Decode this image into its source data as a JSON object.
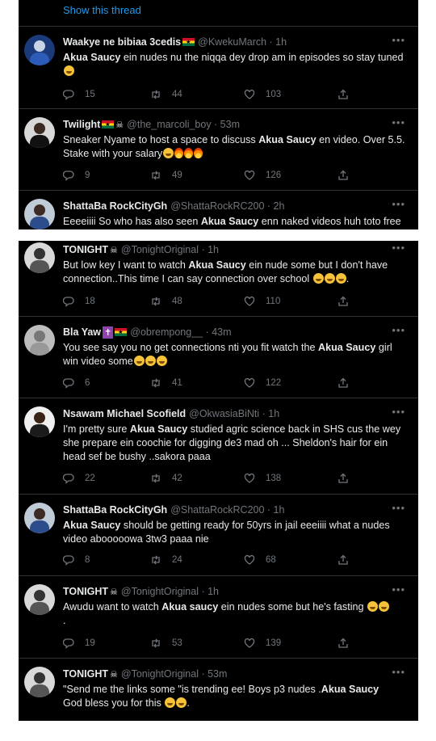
{
  "show_thread": "Show this thread",
  "more_label": "•••",
  "top_tweets": [
    {
      "name": "Waakye ne bibiaa 3cedis",
      "handle": "@KwekuMarch · 1h",
      "text": [
        "Akua Saucy",
        " ein nudes nu the niqqa dey drop am in episodes so stay tuned"
      ],
      "replies": "15",
      "retweets": "44",
      "likes": "103"
    },
    {
      "name": "Twilight",
      "handle": "@the_marcoli_boy · 53m",
      "text": [
        "Sneaker Nyame to host a space to discuss ",
        "Akua Saucy",
        " en video. Over 5.5. Stake with your salary"
      ],
      "replies": "9",
      "retweets": "49",
      "likes": "126"
    },
    {
      "name": "ShattaBa RockCityGh",
      "handle": "@ShattaRockRC200 · 2h",
      "text": [
        "Eeeeiiii So who has also seen ",
        "Akua Saucy",
        " enn naked videos huh toto free download abb aaaii"
      ]
    }
  ],
  "bottom_tweets": [
    {
      "name": "TONIGHT",
      "handle": "@TonightOriginal · 1h",
      "text": [
        "But low key I want to watch ",
        "Akua Saucy",
        " ein nude some but I don't have connection..This time I can say connection over school ",
        "."
      ],
      "replies": "18",
      "retweets": "48",
      "likes": "110"
    },
    {
      "name": "Bla Yaw",
      "handle": "@obrempong__ · 43m",
      "text": [
        "You see say you no get connections nti you fit watch the ",
        "Akua Saucy",
        " girl win video some"
      ],
      "replies": "6",
      "retweets": "41",
      "likes": "122"
    },
    {
      "name": "Nsawam Michael Scofield",
      "handle": "@OkwasiaBiNti · 1h",
      "text": [
        "I'm pretty sure ",
        "Akua Saucy",
        " studied agric science back in SHS cus the wey she prepare ein coochie for digging de3 mad oh ... Sheldon's hair for ein head sef be bushy ..sakora paaa"
      ],
      "replies": "22",
      "retweets": "42",
      "likes": "138"
    },
    {
      "name": "ShattaBa RockCityGh",
      "handle": "@ShattaRockRC200 · 1h",
      "text": [
        "Akua Saucy",
        " should be getting ready for 50yrs in jail eeeiiii what a nudes video abooooowa 3tw3 paaa nie"
      ],
      "replies": "8",
      "retweets": "24",
      "likes": "68"
    },
    {
      "name": "TONIGHT",
      "handle": "@TonightOriginal · 1h",
      "text": [
        "Awudu want to watch ",
        "Akua saucy",
        " ein  nudes some but he's fasting ",
        "."
      ],
      "replies": "19",
      "retweets": "53",
      "likes": "139"
    },
    {
      "name": "TONIGHT",
      "handle": "@TonightOriginal · 53m",
      "text": [
        "\"Send me the links some \"is trending ee! Boys p3 nudes .",
        "Akua Saucy",
        " God  bless you for this "
      ]
    }
  ],
  "colors": {
    "background": "#000000",
    "text": "#e7e9ea",
    "muted": "#71767b",
    "link": "#1d9bf0",
    "divider": "#2f3336"
  },
  "icons": [
    "reply-icon",
    "retweet-icon",
    "like-icon",
    "share-icon",
    "more-icon"
  ]
}
